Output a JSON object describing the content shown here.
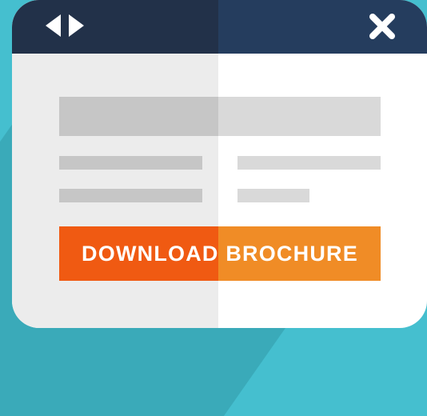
{
  "window": {
    "nav_icons": [
      "chevron-left-icon",
      "chevron-right-icon"
    ],
    "close_icon": "close-icon"
  },
  "cta": {
    "label": "DOWNLOAD BROCHURE"
  },
  "colors": {
    "background": "#45BFCF",
    "titlebar_left": "#223149",
    "titlebar_right": "#253D5E",
    "cta_left": "#F05A12",
    "cta_right": "#F08C26"
  }
}
